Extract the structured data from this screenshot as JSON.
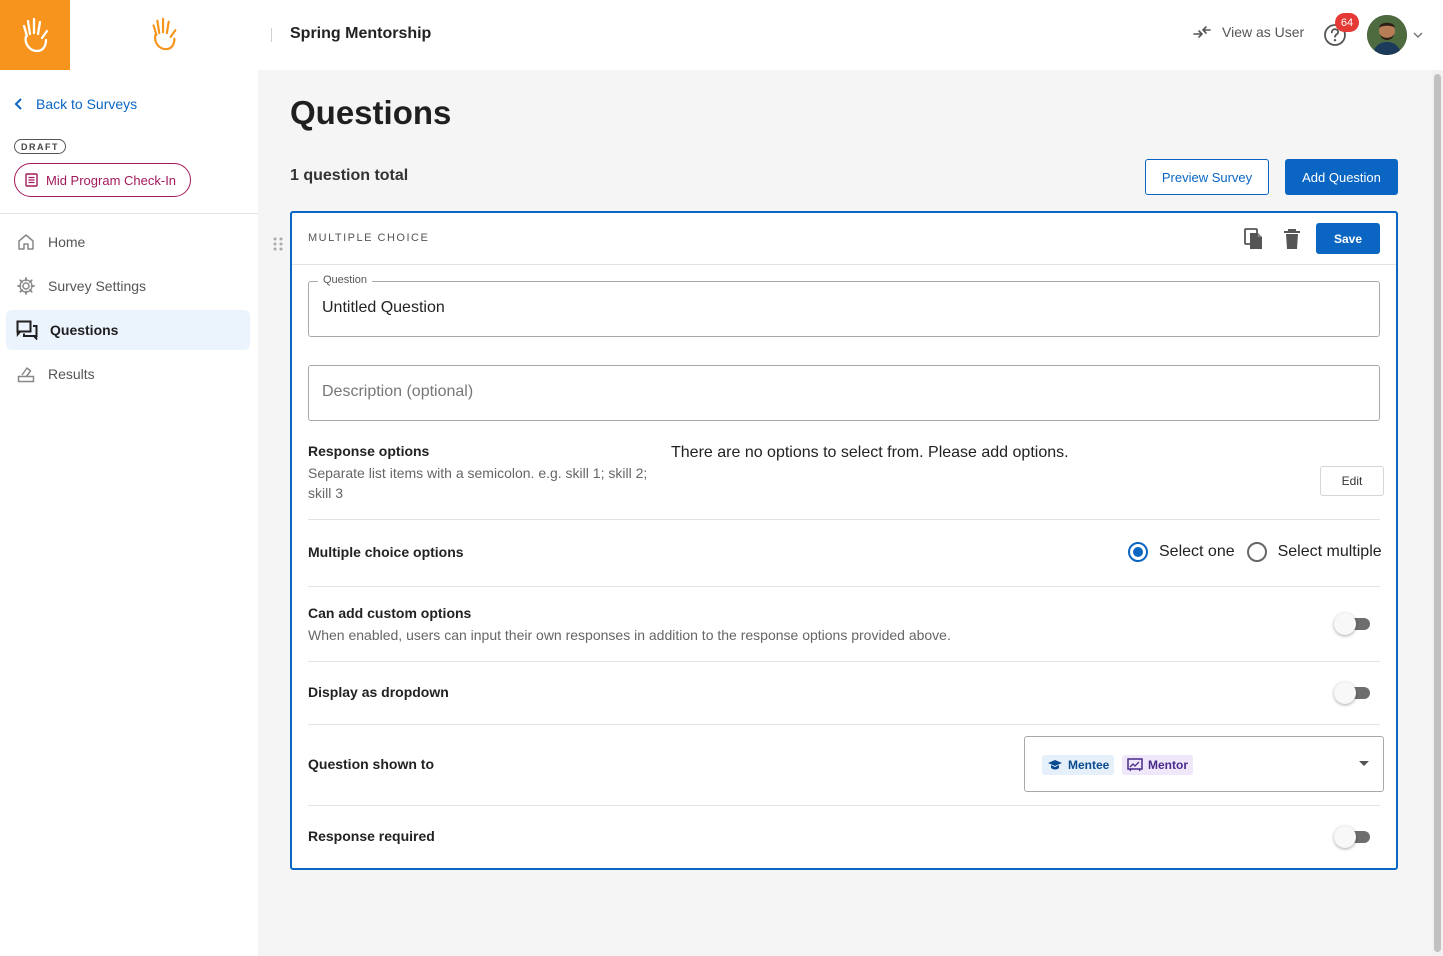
{
  "header": {
    "program_title": "Spring Mentorship",
    "view_as_user": "View as User",
    "notification_count": "64",
    "brand_color": "#f7941d"
  },
  "sidebar": {
    "back_link": "Back to Surveys",
    "status_badge": "DRAFT",
    "survey_name": "Mid Program Check-In",
    "nav": [
      {
        "label": "Home",
        "icon": "home-icon",
        "active": false
      },
      {
        "label": "Survey Settings",
        "icon": "gear-icon",
        "active": false
      },
      {
        "label": "Questions",
        "icon": "questions-icon",
        "active": true
      },
      {
        "label": "Results",
        "icon": "results-icon",
        "active": false
      }
    ]
  },
  "main": {
    "title": "Questions",
    "question_total": "1 question total",
    "preview_button": "Preview Survey",
    "add_button": "Add Question",
    "accent_color": "#0b66c3"
  },
  "question_card": {
    "type_label": "MULTIPLE CHOICE",
    "save_button": "Save",
    "question_field": {
      "label": "Question",
      "value": "Untitled Question"
    },
    "description_field": {
      "placeholder": "Description (optional)",
      "value": ""
    },
    "response_options": {
      "label": "Response options",
      "help": "Separate list items with a semicolon. e.g. skill 1; skill 2; skill 3",
      "empty_message": "There are no options to select from. Please add options.",
      "edit_button": "Edit"
    },
    "multiple_choice": {
      "label": "Multiple choice options",
      "options": [
        "Select one",
        "Select multiple"
      ],
      "selected": "Select one"
    },
    "custom_options": {
      "label": "Can add custom options",
      "help": "When enabled, users can input their own responses in addition to the response options provided above.",
      "enabled": false
    },
    "dropdown": {
      "label": "Display as dropdown",
      "enabled": false
    },
    "shown_to": {
      "label": "Question shown to",
      "roles": [
        "Mentee",
        "Mentor"
      ]
    },
    "required": {
      "label": "Response required",
      "enabled": false
    }
  }
}
